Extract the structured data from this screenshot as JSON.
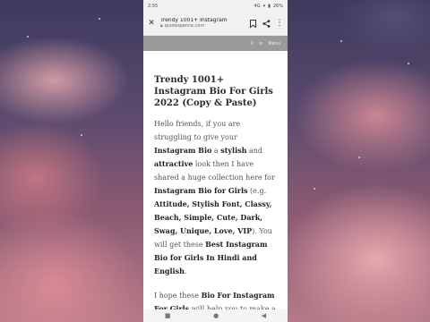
{
  "status": {
    "time": "2:55",
    "signal": "4G",
    "battery": "26%"
  },
  "browser": {
    "page_title": "Trendy 1001+ Instagram",
    "domain": "quotespence.com"
  },
  "site_header": {
    "menu_label": "Menu"
  },
  "article": {
    "title": "Trendy 1001+ Instagram Bio For Girls 2022 (Copy & Paste)",
    "p1": {
      "t1": "Hello friends, if you are struggling to give your ",
      "b1": "Instagram Bio",
      "t2": " a ",
      "b2": "stylish",
      "t3": " and ",
      "b3": "attractive",
      "t4": " look then I have shared a huge collection here for ",
      "b4": "Instagram Bio for Girls",
      "t5": " (e.g. ",
      "b5": "Attitude, Stylish Font, Classy, Beach, Simple, Cute, Dark, Swag, Unique, Love, VIP",
      "t6": "). You will get these ",
      "b6": "Best Instagram Bio for Girls In Hindi and English",
      "t7": "."
    },
    "p2": {
      "t1": "I hope these ",
      "b1": "Bio For Instagram For Girls",
      "t2": " will help you to make a"
    }
  },
  "colors": {
    "page_bg": "#ffffff",
    "header_gray": "#9a9a9a",
    "toolbar_bg": "#f1f1f1"
  }
}
